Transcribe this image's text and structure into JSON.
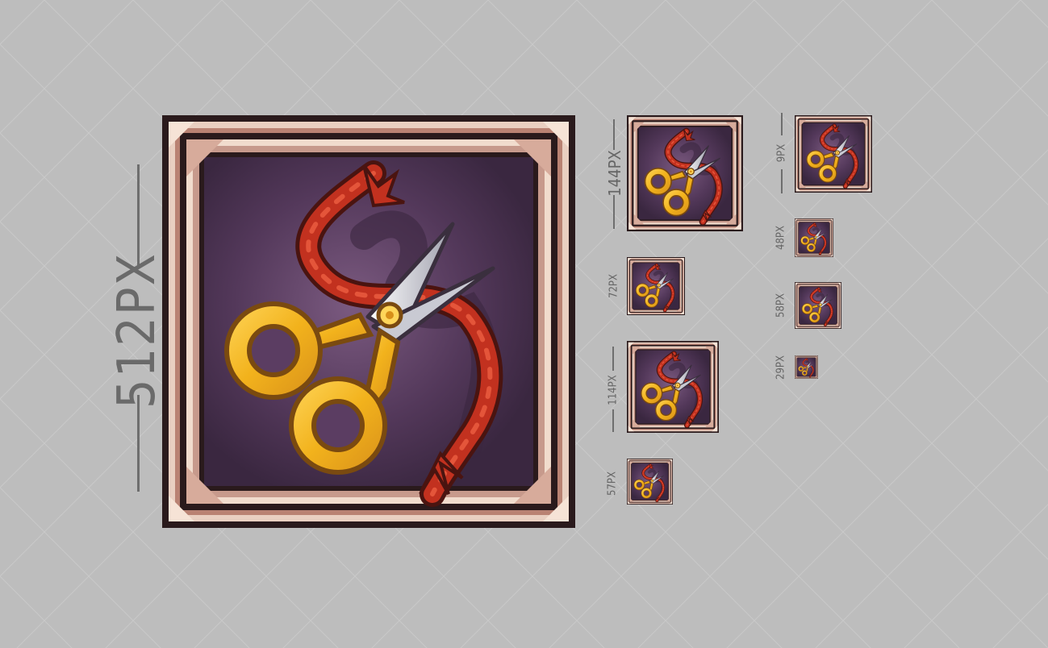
{
  "size_labels": {
    "l512": "512PX",
    "l144": "144PX",
    "l72": "72PX",
    "l114": "114PX",
    "l57": "57PX",
    "l9": "9PX",
    "l48": "48PX",
    "l58": "58PX",
    "l29": "29PX"
  },
  "colors": {
    "background": "#bdbdbd",
    "frame_outer": "#2a1a1c",
    "frame_inner": "#c79a8c",
    "panel": "#4a3450",
    "gold": "#f2b21c",
    "ribbon": "#c2311f"
  },
  "icon_subject": "scissors-with-red-ribbon-icon"
}
